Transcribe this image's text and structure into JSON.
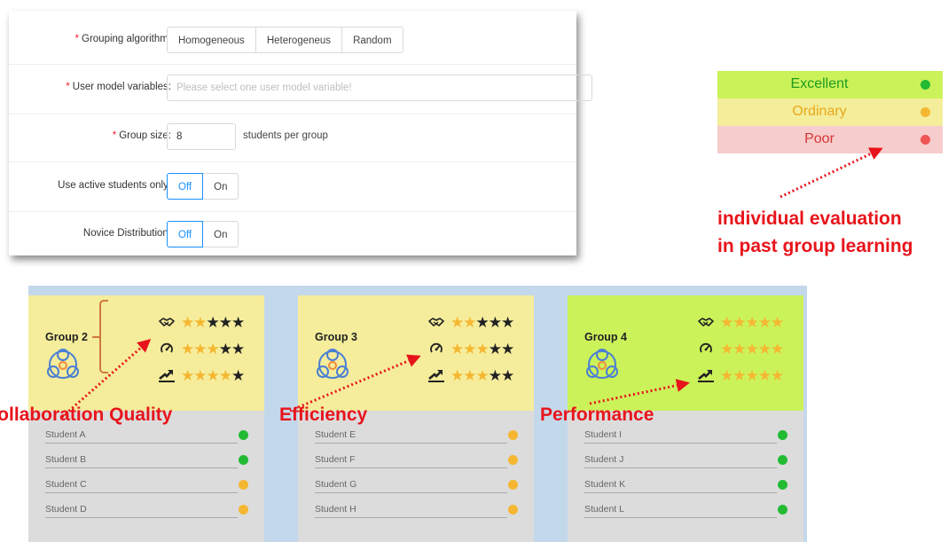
{
  "form": {
    "grouping_algorithm": {
      "label": "Grouping algorithm:",
      "options": [
        "Homogeneous",
        "Heterogeneus",
        "Random"
      ]
    },
    "user_model_variables": {
      "label": "User model variables:",
      "placeholder": "Please select one user model variable!"
    },
    "group_size": {
      "label": "Group size:",
      "value": "8",
      "suffix": "students per group"
    },
    "active_students_only": {
      "label": "Use active students only:",
      "options": [
        "Off",
        "On"
      ],
      "selected": "Off"
    },
    "novice_distribution": {
      "label": "Novice Distribution:",
      "options": [
        "Off",
        "On"
      ],
      "selected": "Off"
    }
  },
  "legend": {
    "items": [
      {
        "label": "Excellent",
        "text_color": "#1d9a1d",
        "bg": "#ccf25a",
        "dot": "#22bb33"
      },
      {
        "label": "Ordinary",
        "text_color": "#e8a81a",
        "bg": "#f4ed9a",
        "dot": "#f5b731"
      },
      {
        "label": "Poor",
        "text_color": "#d93434",
        "bg": "#f6cccc",
        "dot": "#f05555"
      }
    ],
    "annotation": [
      "individual evaluation",
      "in past group learning"
    ]
  },
  "metric_labels": [
    "Collaboration Quality",
    "Efficiency",
    "Performance"
  ],
  "metric_icons": [
    "handshake-icon",
    "speedometer-icon",
    "trend-up-icon"
  ],
  "groups": [
    {
      "name": "Group 2",
      "header_bg": "#f5ed9b",
      "ratings": [
        2,
        3,
        4
      ],
      "students": [
        {
          "name": "Student A",
          "status": "Excellent"
        },
        {
          "name": "Student B",
          "status": "Excellent"
        },
        {
          "name": "Student C",
          "status": "Ordinary"
        },
        {
          "name": "Student D",
          "status": "Ordinary"
        }
      ]
    },
    {
      "name": "Group 3",
      "header_bg": "#f5ed9b",
      "ratings": [
        2,
        3,
        3
      ],
      "students": [
        {
          "name": "Student E",
          "status": "Ordinary"
        },
        {
          "name": "Student F",
          "status": "Ordinary"
        },
        {
          "name": "Student G",
          "status": "Ordinary"
        },
        {
          "name": "Student H",
          "status": "Ordinary"
        }
      ]
    },
    {
      "name": "Group 4",
      "header_bg": "#ccf25a",
      "ratings": [
        5,
        5,
        5
      ],
      "students": [
        {
          "name": "Student I",
          "status": "Excellent"
        },
        {
          "name": "Student J",
          "status": "Excellent"
        },
        {
          "name": "Student K",
          "status": "Excellent"
        },
        {
          "name": "Student L",
          "status": "Excellent"
        }
      ]
    }
  ],
  "colors": {
    "star_on": "#f5b731",
    "star_off": "#222222",
    "annotation_red": "#e8141b",
    "accent_blue": "#1890ff"
  }
}
